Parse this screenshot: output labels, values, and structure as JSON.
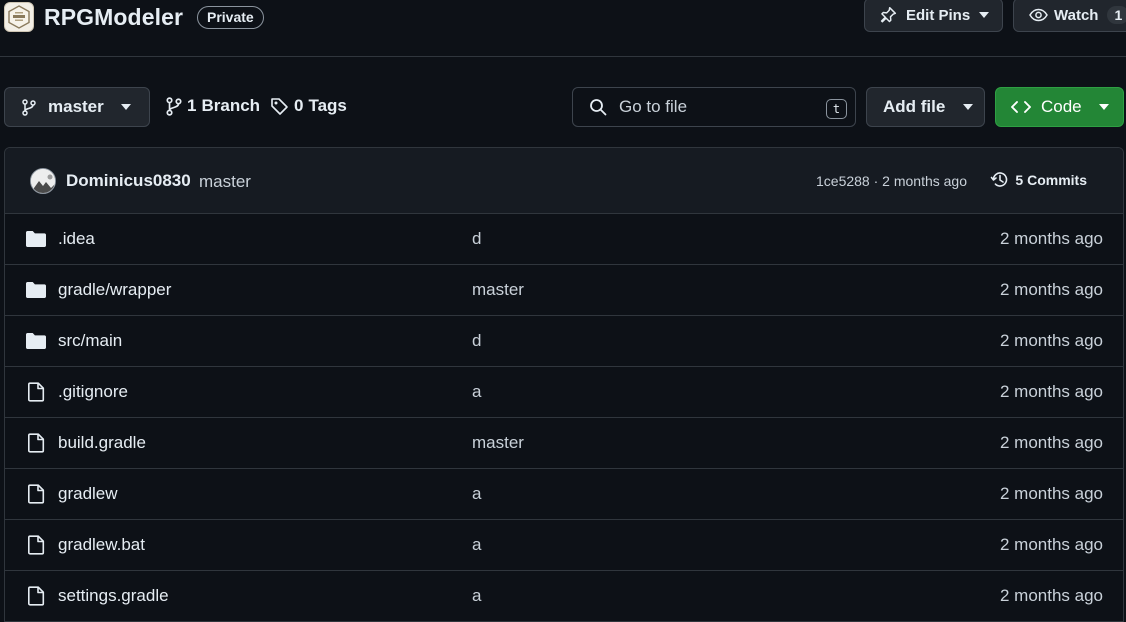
{
  "repo": {
    "name": "RPGModeler",
    "visibility": "Private"
  },
  "header_actions": {
    "edit_pins_label": "Edit Pins",
    "watch_label": "Watch",
    "watch_count": "1"
  },
  "toolbar": {
    "branch_name": "master",
    "branches_count": "1",
    "branches_label": "Branch",
    "tags_count": "0",
    "tags_label": "Tags",
    "go_to_file_placeholder": "Go to file",
    "go_to_file_shortcut": "t",
    "add_file_label": "Add file",
    "code_label": "Code",
    "code_color": "#238636"
  },
  "latest_commit": {
    "author": "Dominicus0830",
    "message": "master",
    "info": "1ce5288 · 2 months ago",
    "commits_label": "5 Commits"
  },
  "files": [
    {
      "name": ".idea",
      "type": "folder",
      "commit": "d",
      "time": "2 months ago"
    },
    {
      "name": "gradle/wrapper",
      "type": "folder",
      "commit": "master",
      "time": "2 months ago"
    },
    {
      "name": "src/main",
      "type": "folder",
      "commit": "d",
      "time": "2 months ago"
    },
    {
      "name": ".gitignore",
      "type": "file",
      "commit": "a",
      "time": "2 months ago"
    },
    {
      "name": "build.gradle",
      "type": "file",
      "commit": "master",
      "time": "2 months ago"
    },
    {
      "name": "gradlew",
      "type": "file",
      "commit": "a",
      "time": "2 months ago"
    },
    {
      "name": "gradlew.bat",
      "type": "file",
      "commit": "a",
      "time": "2 months ago"
    },
    {
      "name": "settings.gradle",
      "type": "file",
      "commit": "a",
      "time": "2 months ago"
    }
  ]
}
